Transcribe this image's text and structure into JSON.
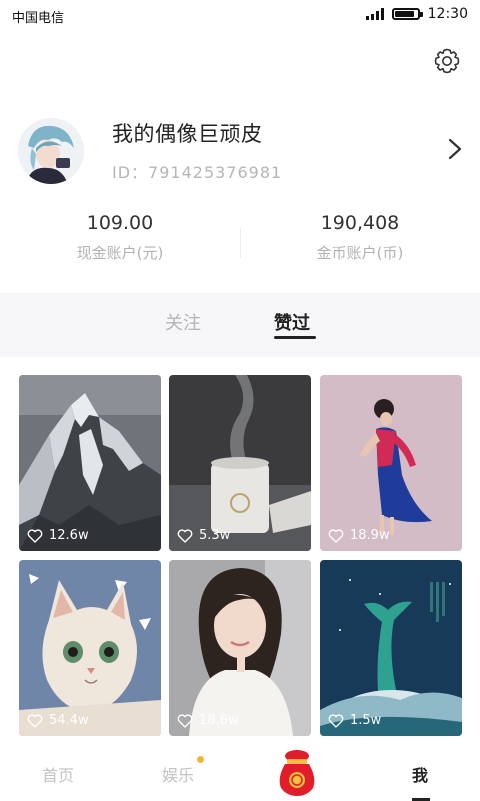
{
  "status_bar": {
    "carrier": "中国电信",
    "time": "12:30",
    "battery_level": 0.85
  },
  "header": {
    "settings_icon": "gear-icon"
  },
  "profile": {
    "name": "我的偶像巨顽皮",
    "id_text": "ID：791425376981"
  },
  "accounts": [
    {
      "value": "109.00",
      "label": "现金账户(元)"
    },
    {
      "value": "190,408",
      "label": "金币账户(币)"
    }
  ],
  "tabs": [
    {
      "label": "关注",
      "active": false
    },
    {
      "label": "赞过",
      "active": true
    }
  ],
  "grid": [
    {
      "likes": "12.6w",
      "subject": "snowy mountain"
    },
    {
      "likes": "5.3w",
      "subject": "humidifier"
    },
    {
      "likes": "18.9w",
      "subject": "dancer in dress"
    },
    {
      "likes": "54.4w",
      "subject": "cat"
    },
    {
      "likes": "18.6w",
      "subject": "portrait"
    },
    {
      "likes": "1.5w",
      "subject": "whale poster"
    }
  ],
  "bottom_nav": [
    {
      "label": "首页",
      "active": false
    },
    {
      "label": "娱乐",
      "active": false,
      "badge": true
    },
    {
      "label": "",
      "icon": "lucky-bag-icon"
    },
    {
      "label": "我",
      "active": true
    }
  ],
  "colors": {
    "badge": "#f5b731",
    "active_text": "#222222",
    "inactive_text": "#c3c3c3"
  }
}
